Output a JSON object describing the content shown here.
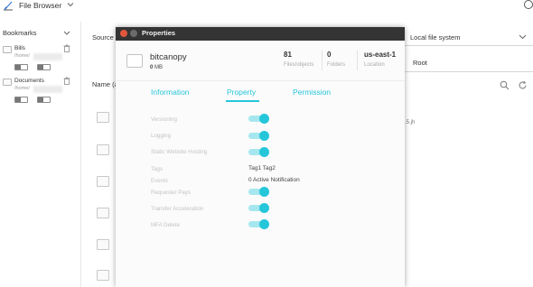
{
  "app": {
    "title": "File Browser"
  },
  "sidebar": {
    "header": "Bookmarks",
    "items": [
      {
        "name": "Bills",
        "path": "/home/"
      },
      {
        "name": "Documents",
        "path": "/home/"
      }
    ]
  },
  "main": {
    "source_label": "Source",
    "name_label": "Name (a",
    "source_select": "Local file system",
    "root_value": "Root",
    "file_suffix": ".5.jh"
  },
  "modal": {
    "title": "Properties",
    "bucket": {
      "name": "bitcanopy",
      "size_value": "0",
      "size_unit": "MB"
    },
    "stats": [
      {
        "value": "81",
        "label": "Files/objects"
      },
      {
        "value": "0",
        "label": "Folders"
      },
      {
        "value": "us-east-1",
        "label": "Location"
      }
    ],
    "tabs": [
      "Information",
      "Property",
      "Permission"
    ],
    "active_tab": "Property",
    "rows": {
      "versioning": {
        "label": "Versioning",
        "on": true
      },
      "logging": {
        "label": "Logging",
        "on": true
      },
      "static_hosting": {
        "label": "Static Website Hosting",
        "on": true
      },
      "tags": {
        "label": "Tags",
        "value": "Tag1 Tag2"
      },
      "events": {
        "label": "Events",
        "value": "0 Active Notification"
      },
      "requester_pays": {
        "label": "Requester Pays",
        "on": true
      },
      "transfer_acceleration": {
        "label": "Transfer Acceleration",
        "on": true
      },
      "mfa_delete": {
        "label": "MFA Delete",
        "on": true
      }
    }
  },
  "colors": {
    "accent": "#26c6da",
    "accent_light": "#a6e7ef",
    "titlebar": "#343434",
    "close_button": "#e2563b"
  }
}
